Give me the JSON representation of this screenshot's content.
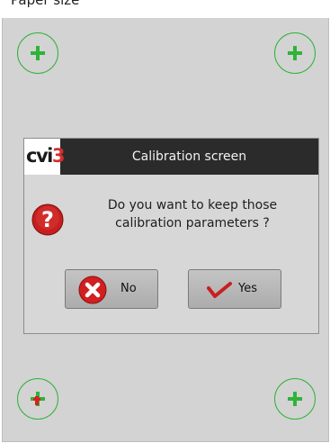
{
  "window": {
    "top_strip_text": "Paper size"
  },
  "dialog": {
    "logo_text": "cvi",
    "logo_accent": "3",
    "title": "Calibration screen",
    "message_line1": "Do you want to keep those",
    "message_line2": "calibration parameters ?",
    "no_label": "No",
    "yes_label": "Yes"
  },
  "colors": {
    "target_green": "#2fb33a",
    "target_red": "#d62020",
    "header_bg": "#2b2b2b",
    "screen_bg": "#d3d3d3"
  },
  "icons": {
    "targets": "plus-icon",
    "question": "question-mark-icon",
    "no": "close-icon",
    "yes": "checkmark-icon"
  }
}
